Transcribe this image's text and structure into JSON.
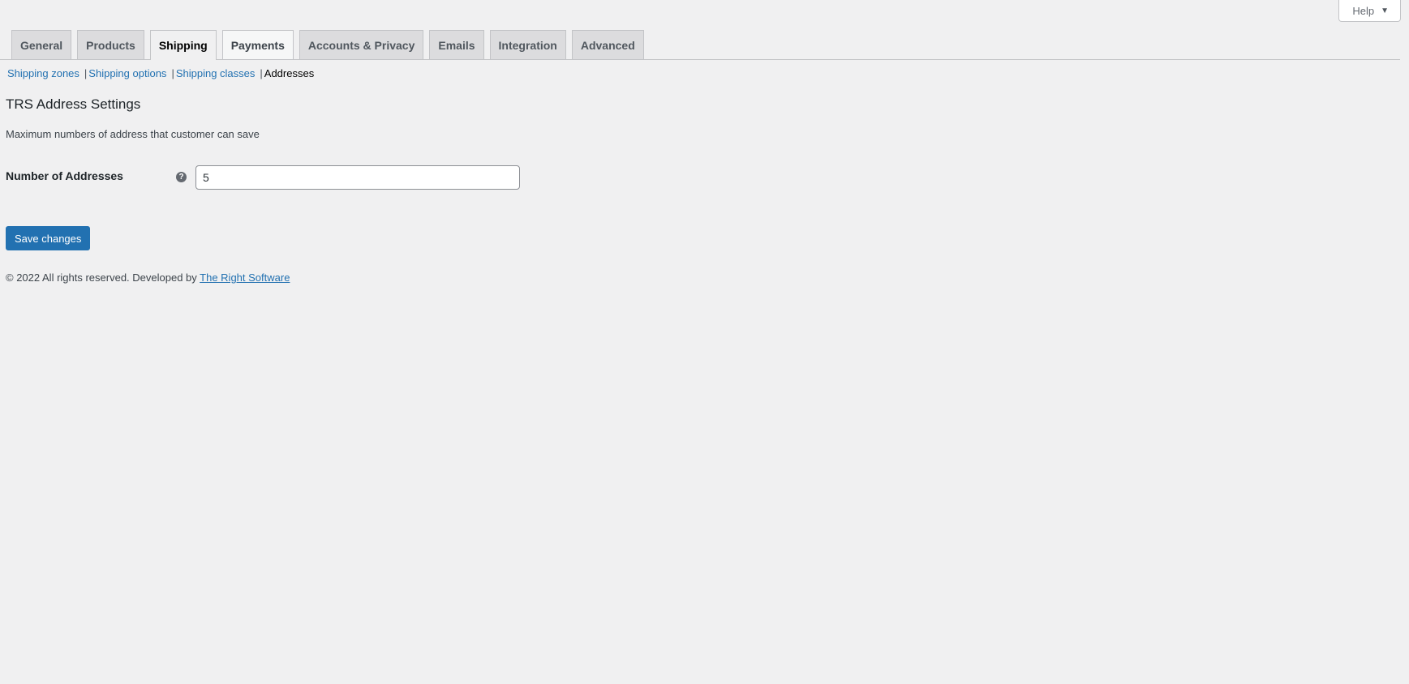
{
  "help": {
    "label": "Help",
    "caret": "▼"
  },
  "tabs": [
    {
      "label": "General"
    },
    {
      "label": "Products"
    },
    {
      "label": "Shipping"
    },
    {
      "label": "Payments"
    },
    {
      "label": "Accounts & Privacy"
    },
    {
      "label": "Emails"
    },
    {
      "label": "Integration"
    },
    {
      "label": "Advanced"
    }
  ],
  "subnav": {
    "items": [
      {
        "label": "Shipping zones"
      },
      {
        "label": "Shipping options"
      },
      {
        "label": "Shipping classes"
      },
      {
        "label": "Addresses"
      }
    ],
    "separator": "|"
  },
  "section": {
    "title": "TRS Address Settings",
    "description": "Maximum numbers of address that customer can save"
  },
  "field": {
    "label": "Number of Addresses",
    "tip_glyph": "?",
    "value": "5"
  },
  "actions": {
    "save_label": "Save changes"
  },
  "footer": {
    "prefix": "© 2022 All rights reserved. Developed by ",
    "link_text": "The Right Software"
  },
  "colors": {
    "accent": "#2271b1",
    "background": "#f0f0f1"
  }
}
